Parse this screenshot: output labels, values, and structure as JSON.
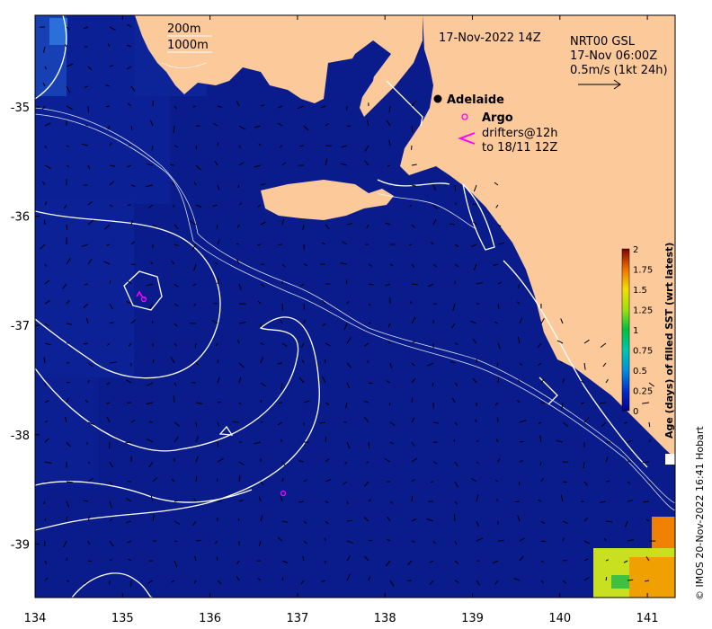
{
  "map": {
    "date_label": "17-Nov-2022 14Z",
    "contour_labels": [
      "200m",
      "1000m"
    ],
    "product_label": "NRT00 GSL",
    "vector_time": "17-Nov 06:00Z",
    "vector_scale": "0.5m/s (1kt 24h)",
    "city": "Adelaide",
    "argo_label": "Argo",
    "drifters_line1": "drifters@12h",
    "drifters_line2": "to 18/11 12Z",
    "credit": "© IMOS 20-Nov-2022 16:41 Hobart",
    "x_ticks": [
      "134",
      "135",
      "136",
      "137",
      "138",
      "139",
      "140",
      "141"
    ],
    "y_ticks": [
      "-35",
      "-36",
      "-37",
      "-38",
      "-39"
    ],
    "colorbar": {
      "label": "Age (days) of filled SST (wrt latest)",
      "ticks": [
        "0",
        "0.25",
        "0.5",
        "0.75",
        "1",
        "1.25",
        "1.5",
        "1.75",
        "2"
      ],
      "range": [
        0,
        2
      ]
    },
    "colors": {
      "ocean": "#0a1c8c",
      "land": "#fcc99b",
      "contour": "#ffffff",
      "argo": "#ff00ff",
      "city": "#000000"
    }
  }
}
